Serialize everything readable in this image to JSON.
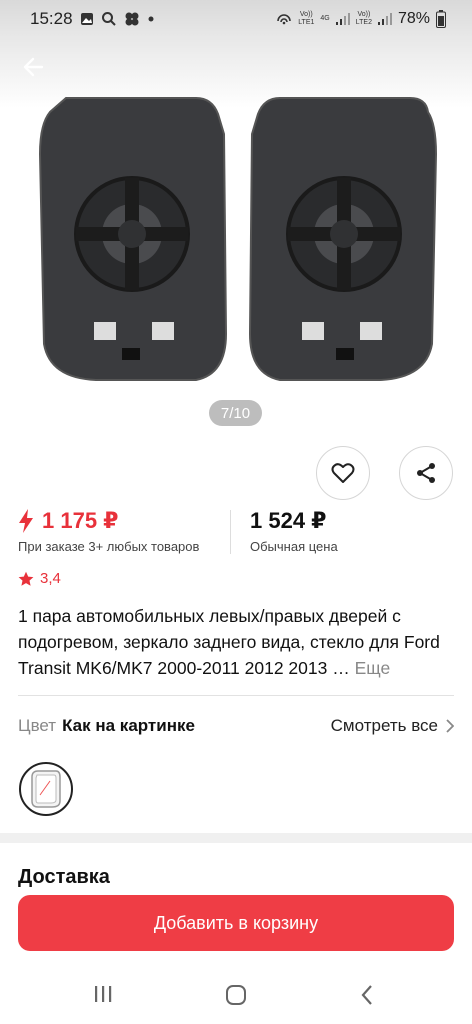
{
  "status_bar": {
    "time": "15:28",
    "net1_top": "Vo))",
    "net1_bottom": "LTE1",
    "net_type": "4G",
    "net2_top": "Vo))",
    "net2_bottom": "LTE2",
    "battery": "78%",
    "icons": [
      "gallery-icon",
      "search-icon",
      "fan-icon",
      "dot-icon",
      "hotspot-icon",
      "signal-icon",
      "battery-icon"
    ]
  },
  "gallery": {
    "page_indicator": "7/10"
  },
  "price": {
    "discount_price": "1 175 ₽",
    "discount_note": "При заказе 3+ любых товаров",
    "regular_price": "1 524 ₽",
    "regular_note": "Обычная цена"
  },
  "rating": {
    "value": "3,4"
  },
  "product": {
    "title": "1 пара автомобильных левых/правых дверей с подогревом, зеркало заднего вида, стекло для Ford Transit MK6/MK7 2000-2011 2012 2013 …",
    "more_label": "Еще"
  },
  "color": {
    "label": "Цвет",
    "value": "Как на картинке",
    "see_all": "Смотреть все"
  },
  "delivery": {
    "title": "Доставка"
  },
  "cart": {
    "button_label": "Добавить в корзину"
  },
  "colors": {
    "accent": "#ef3d45",
    "price_red": "#e8313a"
  }
}
